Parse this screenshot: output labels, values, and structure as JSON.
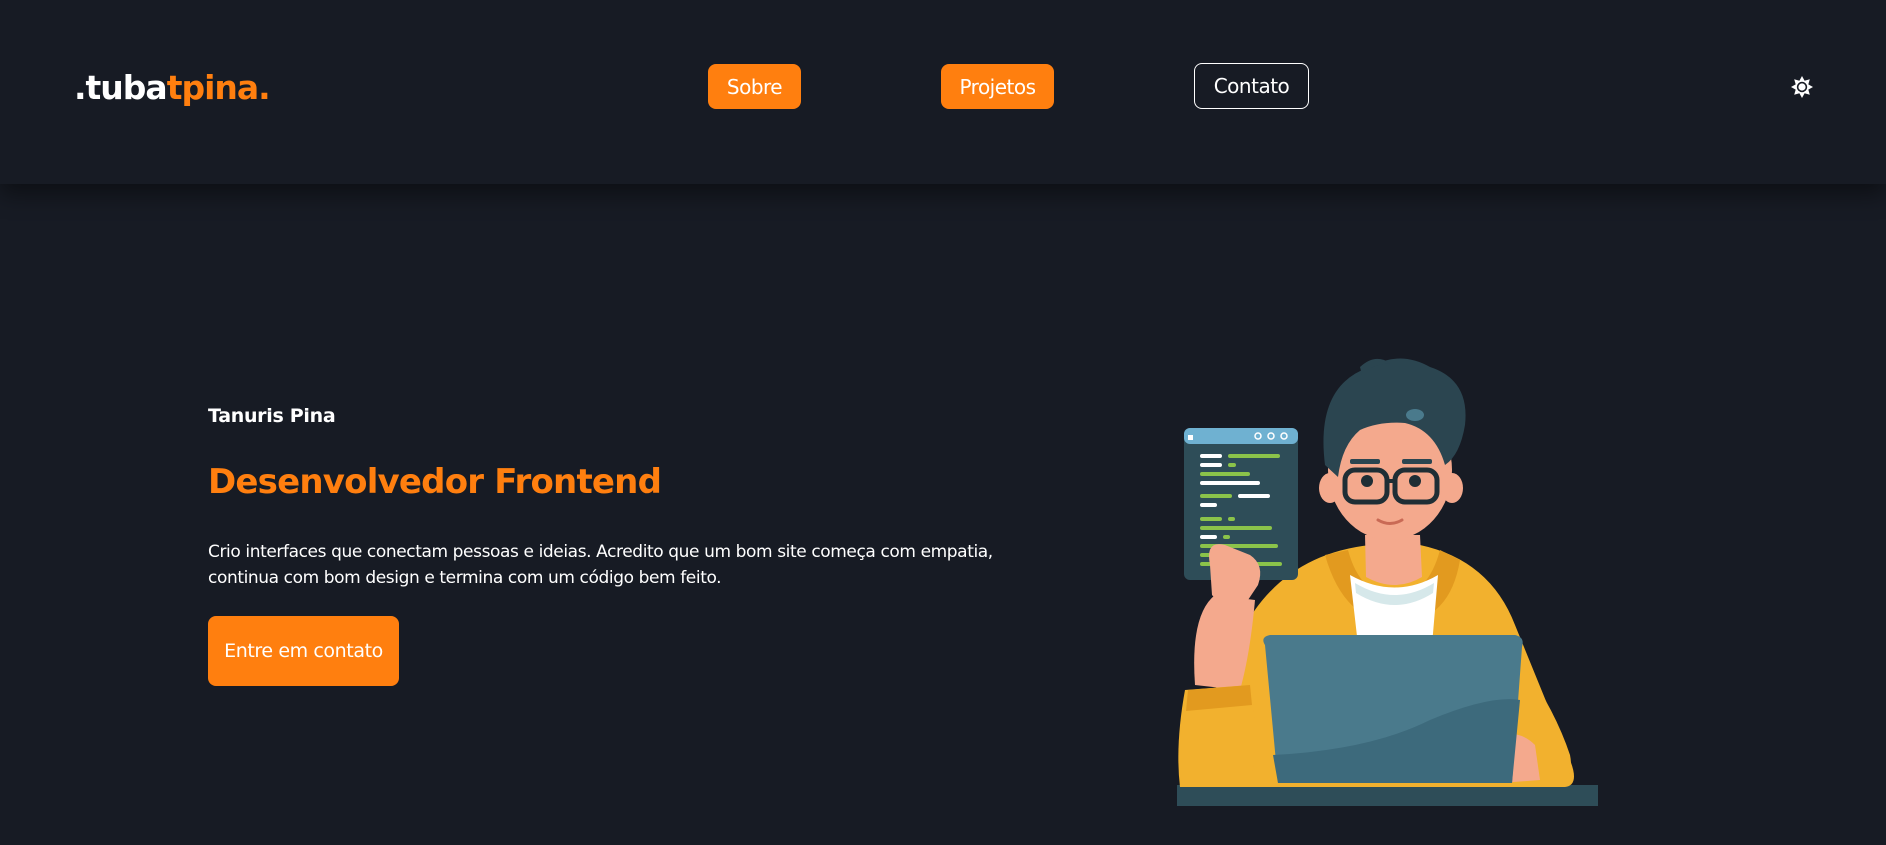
{
  "header": {
    "logo": {
      "part1": ".tuba",
      "part2": "tpina."
    },
    "nav": {
      "sobre": "Sobre",
      "projetos": "Projetos",
      "contato": "Contato"
    },
    "theme_toggle_icon": "sun-icon"
  },
  "hero": {
    "name": "Tanuris Pina",
    "title": "Desenvolvedor Frontend",
    "description_line1": "Crio interfaces que conectam pessoas e ideias. Acredito que um bom site começa com empatia,",
    "description_line2": "continua com bom design e termina com um código bem feito.",
    "cta_label": "Entre em contato",
    "illustration_icon": "developer-illustration"
  },
  "colors": {
    "background": "#171b24",
    "accent": "#ff7f0f",
    "text": "#ffffff"
  }
}
